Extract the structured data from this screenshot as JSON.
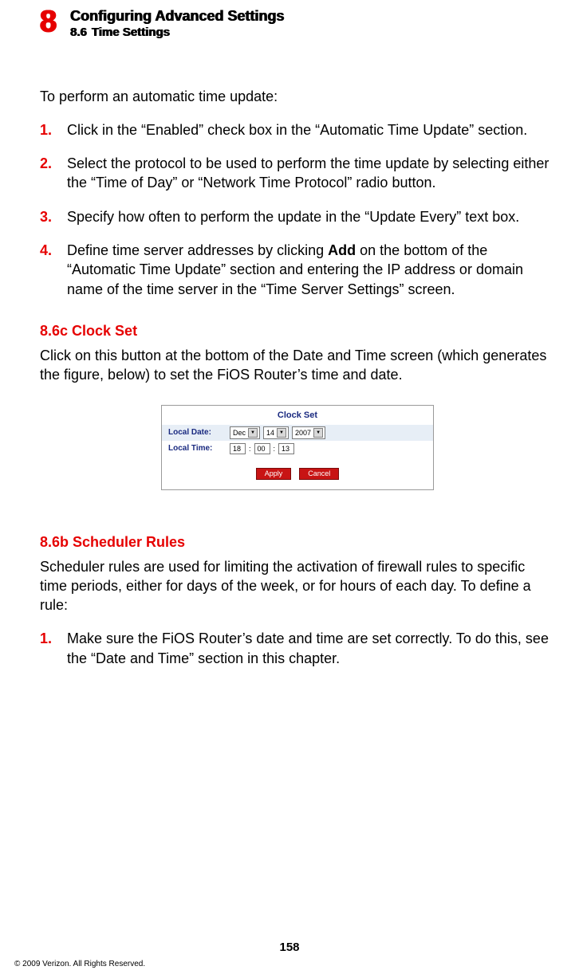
{
  "header": {
    "chapter_number": "8",
    "chapter_title": "Configuring Advanced Settings",
    "section_number": "8.6",
    "section_title": "Time Settings"
  },
  "intro": "To perform an automatic time update:",
  "steps1": [
    {
      "num": "1.",
      "text": "Click in the “Enabled” check box in the “Automatic Time Update” section."
    },
    {
      "num": "2.",
      "text": "Select the protocol to be used to perform the time update by selecting either the “Time of Day” or “Network Time Protocol” radio button."
    },
    {
      "num": "3.",
      "text": "Specify how often to perform the update in the “Update Every” text box."
    },
    {
      "num": "4.",
      "pre": "Define time server addresses by clicking ",
      "bold": "Add",
      "post": " on the bottom of the “Automatic Time Update” section and entering the IP address or domain name of the time server in the “Time Server Settings” screen."
    }
  ],
  "section_86c": {
    "heading": "8.6c  Clock Set",
    "para": "Click on this button at the bottom of the Date and Time screen (which generates the figure, below) to set the FiOS Router’s time and date."
  },
  "clockset": {
    "title": "Clock Set",
    "local_date_label": "Local Date:",
    "local_time_label": "Local Time:",
    "month": "Dec",
    "day": "14",
    "year": "2007",
    "hh": "18",
    "mm": "00",
    "ss": "13",
    "apply": "Apply",
    "cancel": "Cancel"
  },
  "section_86b": {
    "heading": "8.6b  Scheduler Rules",
    "para": "Scheduler rules are used for limiting the activation of firewall rules to specific time periods, either for days of the week, or for hours of each day.  To define a rule:"
  },
  "steps2": [
    {
      "num": "1.",
      "text": "Make sure the FiOS Router’s date and time are set correctly. To do this, see the “Date and Time” section in this chapter."
    }
  ],
  "page_number": "158",
  "copyright": "© 2009 Verizon. All Rights Reserved."
}
